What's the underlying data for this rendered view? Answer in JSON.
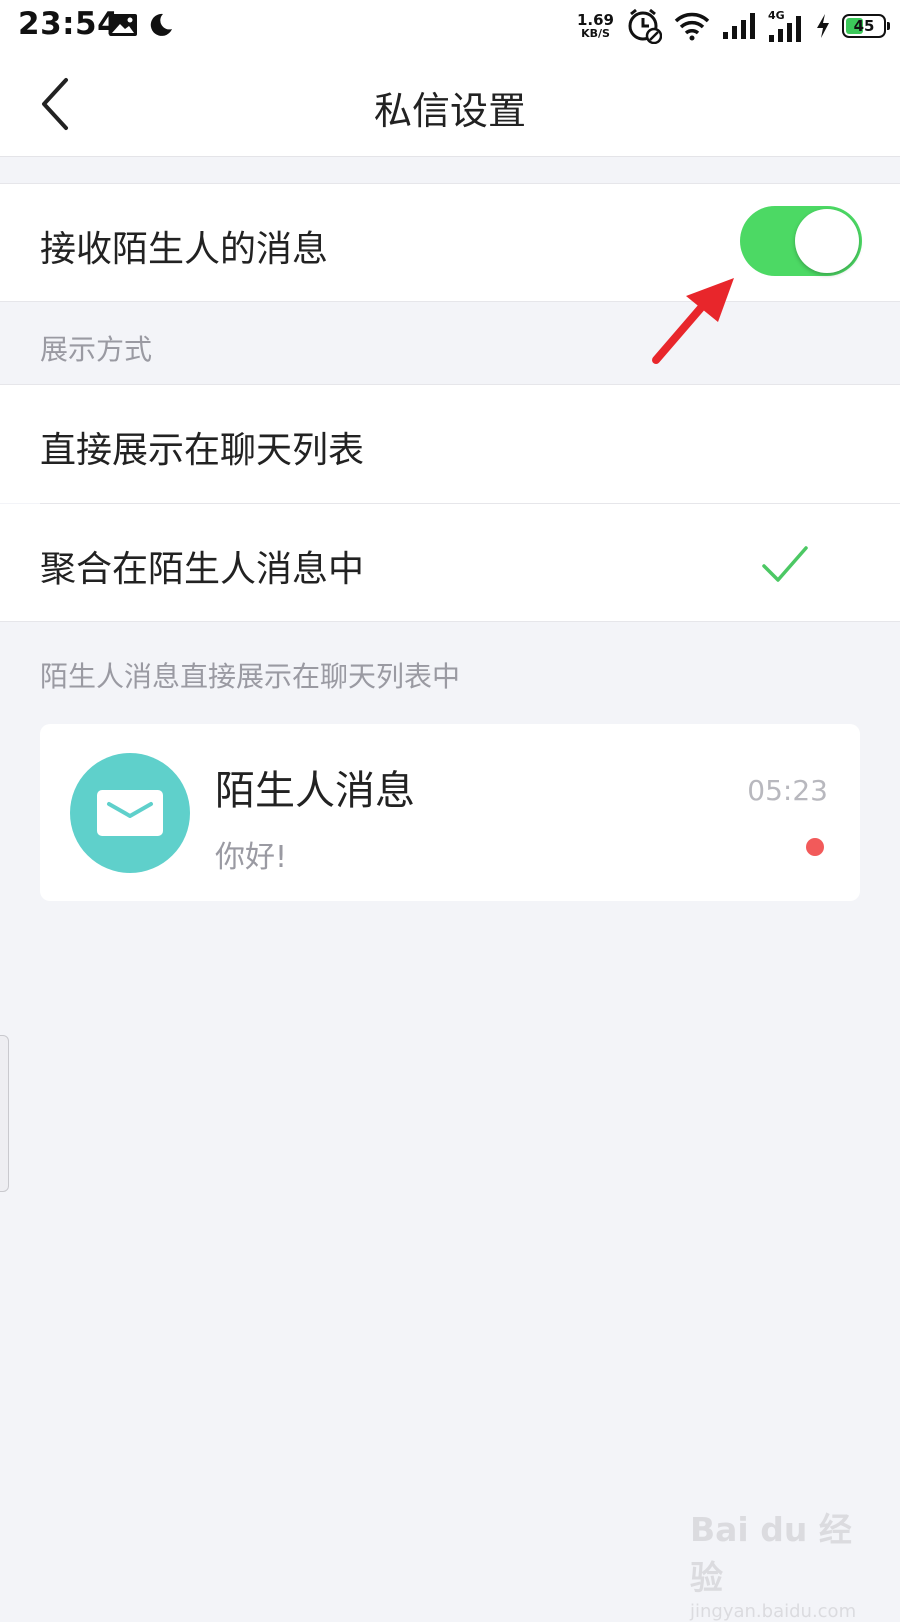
{
  "status_bar": {
    "time": "23:54",
    "speed_value": "1.69",
    "speed_unit": "KB/S",
    "network_label": "4G",
    "battery_level": "45",
    "icons": [
      "image-icon",
      "moon-icon",
      "alarm-icon",
      "wifi-icon",
      "signal-icon",
      "signal-4g-icon",
      "charging-icon",
      "battery-icon"
    ]
  },
  "nav": {
    "title": "私信设置",
    "back_icon": "chevron-left-icon"
  },
  "settings": {
    "receive_strangers_label": "接收陌生人的消息",
    "receive_strangers_enabled": true,
    "display_section_label": "展示方式",
    "display_options": [
      {
        "label": "直接展示在聊天列表",
        "selected": false
      },
      {
        "label": "聚合在陌生人消息中",
        "selected": true
      }
    ],
    "footer_note": "陌生人消息直接展示在聊天列表中"
  },
  "preview": {
    "title": "陌生人消息",
    "message": "你好!",
    "time": "05:23",
    "avatar_icon": "envelope-icon",
    "unread_dot_color": "#f25a5a"
  },
  "watermark": {
    "logo": "Bai du 经验",
    "url": "jingyan.baidu.com"
  },
  "colors": {
    "toggle_on": "#4cd964",
    "checkmark": "#4cc864",
    "avatar_bg": "#5fd0cb",
    "annotation_arrow": "#e8262b"
  }
}
